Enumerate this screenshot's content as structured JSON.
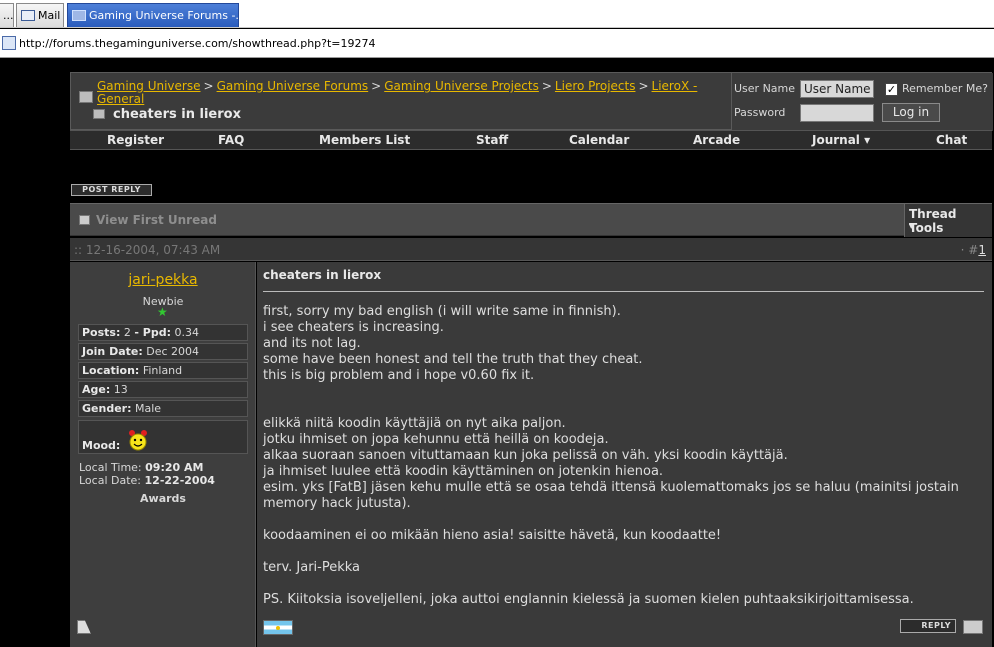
{
  "browser": {
    "tabs": [
      {
        "label": "..."
      },
      {
        "label": "Mail"
      },
      {
        "label": "Gaming Universe Forums -..."
      }
    ],
    "url": "http://forums.thegaminguniverse.com/showthread.php?t=19274"
  },
  "breadcrumbs": [
    {
      "label": "Gaming Universe"
    },
    {
      "label": "Gaming Universe Forums"
    },
    {
      "label": "Gaming Universe Projects"
    },
    {
      "label": "Liero Projects"
    },
    {
      "label": "LieroX - General"
    }
  ],
  "breadcrumb_separator": ">",
  "thread_title": "cheaters in lierox",
  "login": {
    "username_label": "User Name",
    "username_value": "User Name",
    "remember_label": "Remember Me?",
    "remember_checked": true,
    "password_label": "Password",
    "login_button": "Log in"
  },
  "menu": [
    {
      "label": "Register"
    },
    {
      "label": "FAQ"
    },
    {
      "label": "Members List"
    },
    {
      "label": "Staff"
    },
    {
      "label": "Calendar"
    },
    {
      "label": "Arcade"
    },
    {
      "label": "Journal ▾"
    },
    {
      "label": "Chat"
    }
  ],
  "post_reply_label": "POST REPLY",
  "toolbar": {
    "view_first_unread": "View First Unread",
    "thread_tools": "Thread Tools",
    "thread_tools_caret": "▾"
  },
  "post": {
    "date": ":: 12-16-2004, 07:43 AM",
    "number_prefix": "· #",
    "number": "1",
    "title": "cheaters in lierox",
    "lines": [
      "first, sorry my bad english (i will write same in finnish).",
      "i see cheaters is increasing.",
      "and its not lag.",
      "some have been honest and tell the truth that they cheat.",
      "this is big problem and i hope v0.60 fix it.",
      "",
      "",
      "elikkä niitä koodin käyttäjiä on nyt aika paljon.",
      "jotku ihmiset on jopa kehunnu että heillä on koodeja.",
      "alkaa suoraan sanoen vituttamaan kun joka pelissä on väh. yksi koodin käyttäjä.",
      "ja ihmiset luulee että koodin käyttäminen on jotenkin hienoa.",
      "esim. yks [FatB] jäsen kehu mulle että se osaa tehdä ittensä kuolemattomaks jos se haluu (mainitsi jostain memory hack jutusta).",
      "",
      "koodaaminen ei oo mikään hieno asia! saisitte hävetä, kun koodaatte!",
      "",
      "terv. Jari-Pekka",
      "",
      "PS. Kiitoksia isoveljelleni, joka auttoi englannin kielessä ja suomen kielen puhtaaksikirjoittamisessa."
    ],
    "reply_label": "REPLY"
  },
  "user": {
    "name": "jari-pekka",
    "title": "Newbie",
    "star": "★",
    "posts_label": "Posts:",
    "posts": "2",
    "ppd_label": "- Ppd:",
    "ppd": "0.34",
    "join_label": "Join Date:",
    "join": "Dec 2004",
    "location_label": "Location:",
    "location": "Finland",
    "age_label": "Age:",
    "age": "13",
    "gender_label": "Gender:",
    "gender": "Male",
    "mood_label": "Mood:",
    "local_time_label": "Local Time:",
    "local_time": "09:20 AM",
    "local_date_label": "Local Date:",
    "local_date": "12-22-2004",
    "awards": "Awards"
  },
  "colors": {
    "link": "#e8b800",
    "panel": "#3e3e3e",
    "background": "#000000"
  }
}
